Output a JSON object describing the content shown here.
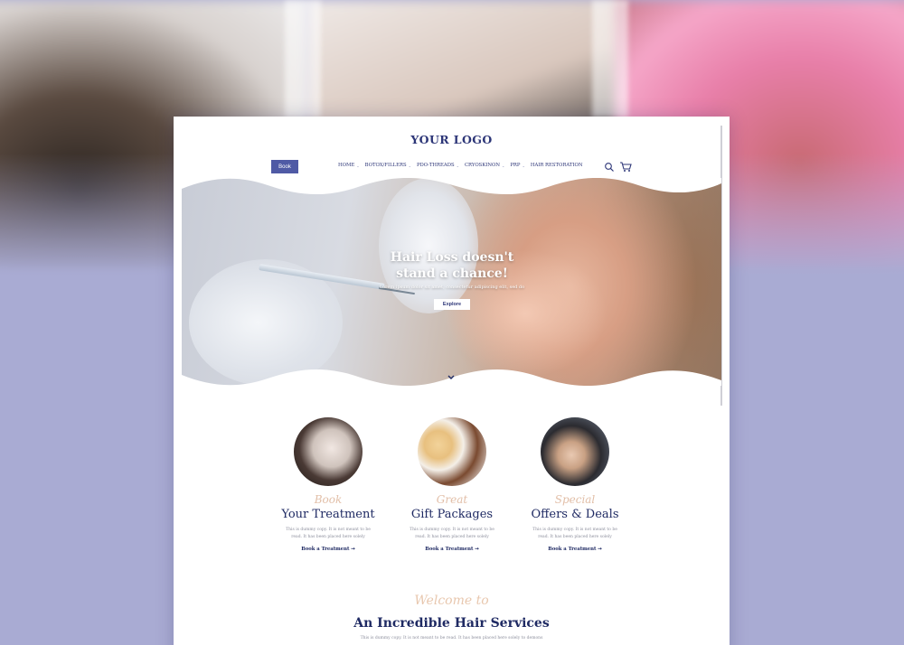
{
  "brand": {
    "logo": "YOUR LOGO"
  },
  "header": {
    "book_label": "Book",
    "nav": [
      "HOME",
      "BOTOX/FILLERS",
      "PDO-THREADS",
      "CRYOSKINON",
      "PRP",
      "HAIR RESTORATION"
    ]
  },
  "icons": {
    "search": "search-icon",
    "cart": "cart-icon",
    "scroll": "chevron-down-icon"
  },
  "hero": {
    "title_line1": "Hair Loss doesn't",
    "title_line2": "stand a chance!",
    "subtitle": "Lorem ipsum dolor sit amet, consectetur adipiscing elit, sed do",
    "button_label": "Explore"
  },
  "cards": [
    {
      "script": "Book",
      "title": "Your Treatment",
      "desc": "This is dummy copy. It is not meant to be read. It has been placed here solely",
      "link": "Book a Treatment"
    },
    {
      "script": "Great",
      "title": "Gift Packages",
      "desc": "This is dummy copy. It is not meant to be read. It has been placed here solely",
      "link": "Book a Treatment"
    },
    {
      "script": "Special",
      "title": "Offers & Deals",
      "desc": "This is dummy copy. It is not meant to be read. It has been placed here solely",
      "link": "Book a Treatment"
    }
  ],
  "welcome": {
    "script": "Welcome to",
    "title": "An Incredible Hair Services",
    "desc": "This is dummy copy. It is not meant to be read. It has been placed here solely to demons"
  },
  "colors": {
    "accent": "#4f5aa5",
    "navy": "#1f2a63",
    "peach": "#e2bfa8",
    "backdrop": "#a9abd3"
  }
}
